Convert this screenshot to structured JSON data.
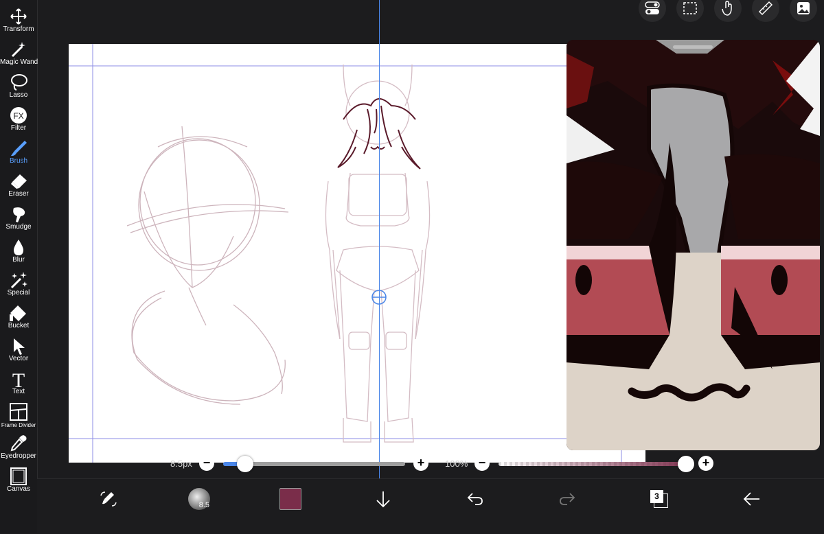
{
  "tools": [
    {
      "label": "Transform",
      "icon": "transform-icon"
    },
    {
      "label": "Magic Wand",
      "icon": "magic-wand-icon"
    },
    {
      "label": "Lasso",
      "icon": "lasso-icon"
    },
    {
      "label": "Filter",
      "icon": "filter-icon"
    },
    {
      "label": "Brush",
      "icon": "brush-icon",
      "active": true
    },
    {
      "label": "Eraser",
      "icon": "eraser-icon"
    },
    {
      "label": "Smudge",
      "icon": "smudge-icon"
    },
    {
      "label": "Blur",
      "icon": "blur-icon"
    },
    {
      "label": "Special",
      "icon": "special-icon"
    },
    {
      "label": "Bucket",
      "icon": "bucket-icon"
    },
    {
      "label": "Vector",
      "icon": "vector-icon"
    },
    {
      "label": "Text",
      "icon": "text-icon"
    },
    {
      "label": "Frame Divider",
      "icon": "frame-divider-icon"
    },
    {
      "label": "Eyedropper",
      "icon": "eyedropper-icon"
    },
    {
      "label": "Canvas",
      "icon": "canvas-icon"
    }
  ],
  "filter_glyph": "FX",
  "text_glyph": "T",
  "top_buttons": [
    "toggle-icon",
    "selection-icon",
    "hand-icon",
    "ruler-icon",
    "image-icon"
  ],
  "brush_size": {
    "label": "8.5px",
    "minus": "−",
    "plus": "+",
    "value": 0.12
  },
  "opacity": {
    "label": "100%",
    "minus": "−",
    "plus": "+",
    "value": 1.0
  },
  "bottom": {
    "brush_preview_size": "8.5",
    "layer_count": "3",
    "current_color": "#7a2d4a"
  },
  "colors": {
    "accent": "#4a86e8",
    "sketch": "#c8aab4",
    "lineart": "#5a1a2a"
  }
}
